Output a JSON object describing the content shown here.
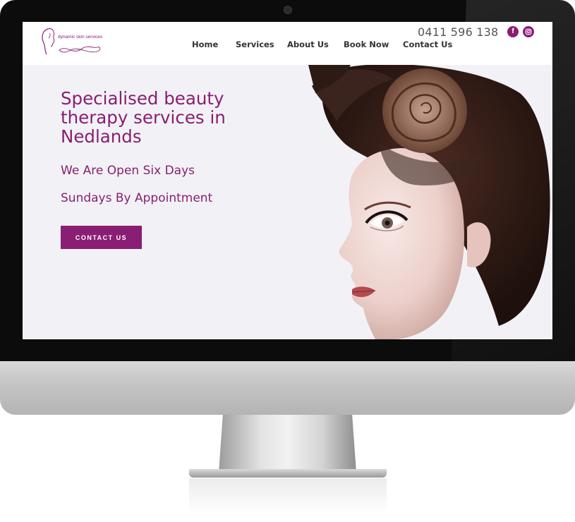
{
  "site": {
    "logo_text": "dynamic skin services",
    "phone": "0411 596 138",
    "social": {
      "facebook": "f",
      "instagram_icon": "instagram-icon"
    },
    "nav": [
      {
        "label": "Home"
      },
      {
        "label": "Services"
      },
      {
        "label": "About Us"
      },
      {
        "label": "Book Now"
      },
      {
        "label": "Contact Us"
      }
    ]
  },
  "hero": {
    "headline": "Specialised beauty therapy services in Nedlands",
    "line1": "We Are Open Six Days",
    "line2": "Sundays By Appointment",
    "cta": "CONTACT US"
  },
  "colors": {
    "brand": "#8a1d74",
    "hero_bg": "#f2f2f6",
    "bezel": "#0c0c0c"
  }
}
